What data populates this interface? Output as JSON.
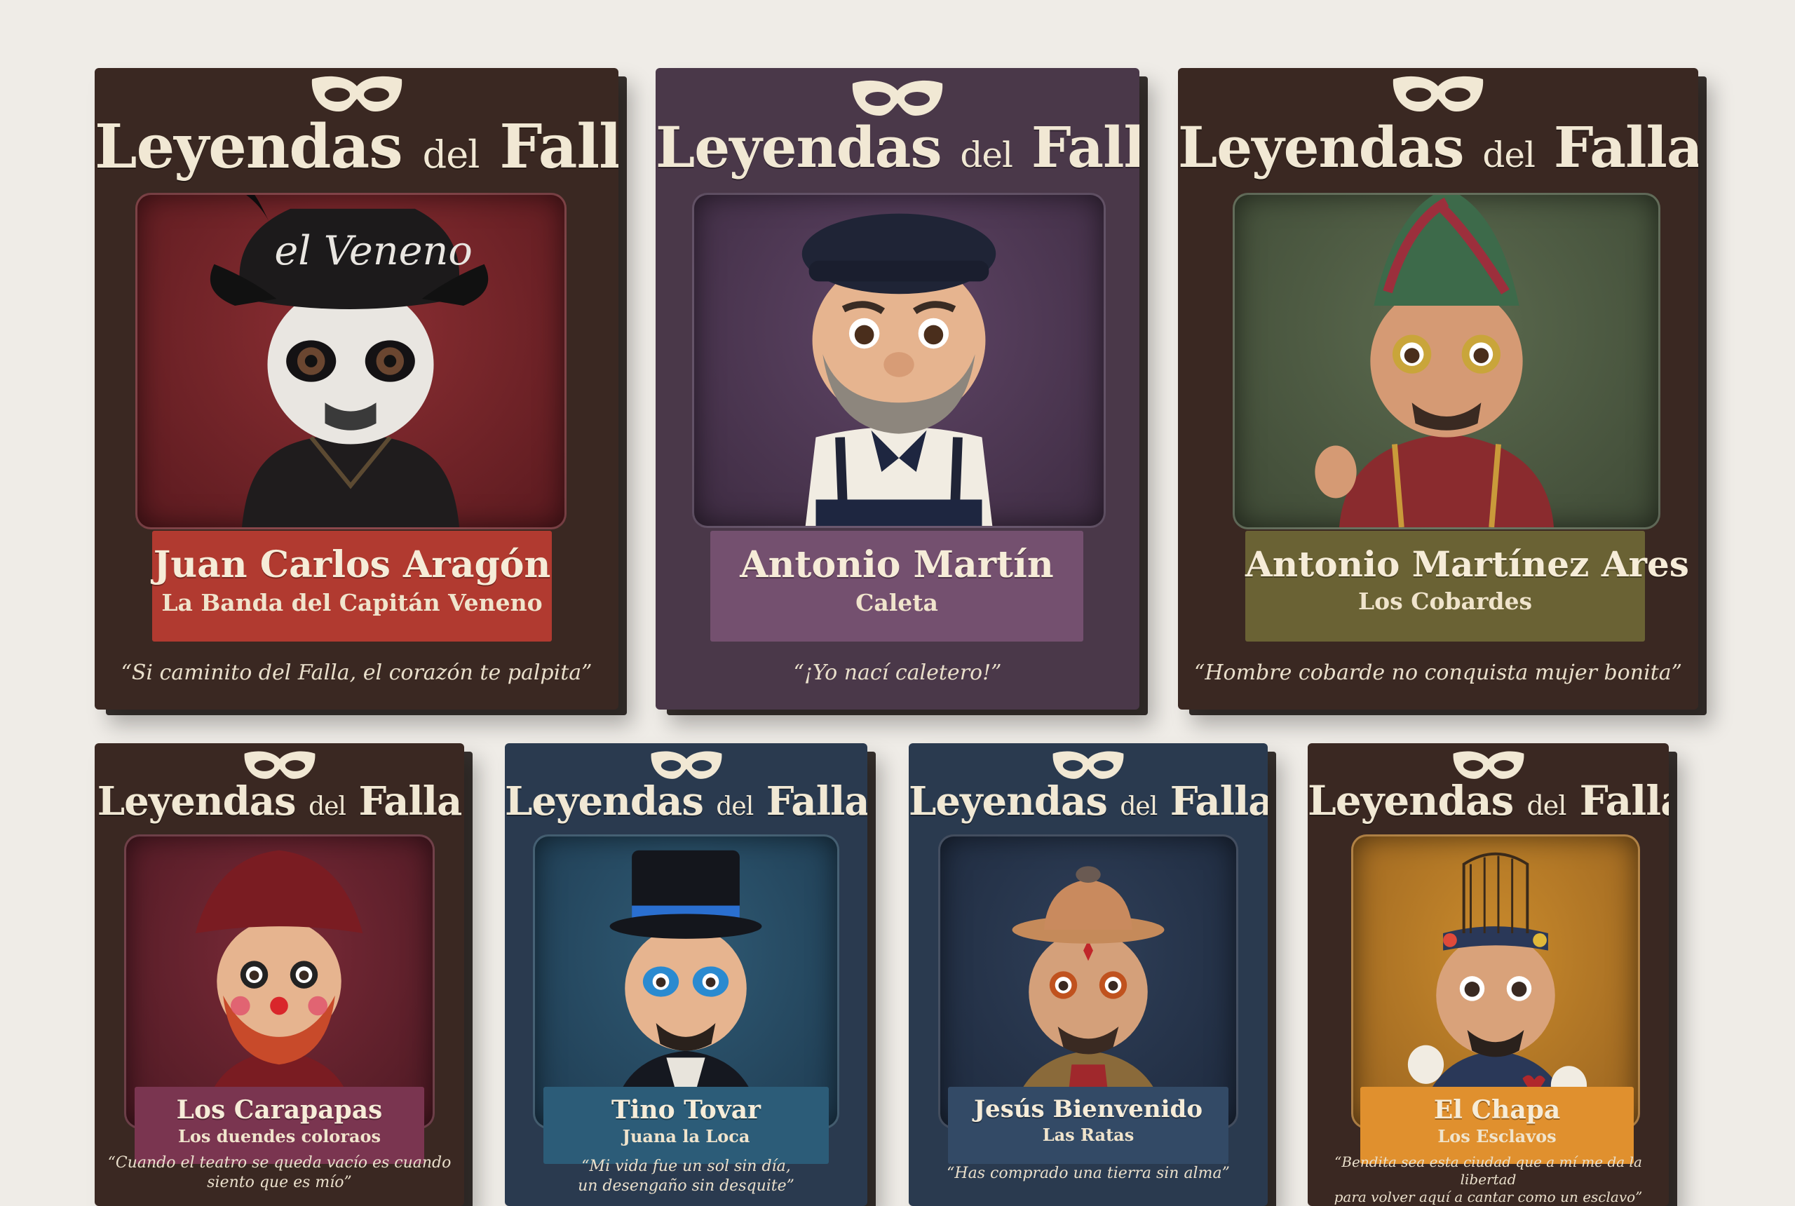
{
  "brand": {
    "title_main": "Leyendas",
    "title_small": "del",
    "title_end": "Falla",
    "icon": "carnival-mask-icon"
  },
  "colors": {
    "background": "#efece7",
    "card_brown": "#3b2a24",
    "card_purple": "#4a3849",
    "card_navy": "#2a3a4f",
    "text_cream": "#f1e8d4"
  },
  "cards": [
    {
      "name": "Juan Carlos Aragón",
      "group": "La Banda del Capitán Veneno",
      "quote": "“Si caminito del Falla,  el corazón te palpita”",
      "hat_text": "el Veneno"
    },
    {
      "name": "Antonio Martín",
      "group": "Caleta",
      "quote": "“¡Yo nací caletero!”"
    },
    {
      "name": "Antonio Martínez Ares",
      "group": "Los Cobardes",
      "quote": "“Hombre cobarde no conquista mujer bonita”"
    },
    {
      "name": "Los  Carapapas",
      "group": "Los duendes coloraos",
      "quote_line1": "“Cuando el teatro se queda vacío es cuando",
      "quote_line2": "siento que es mío”"
    },
    {
      "name": "Tino Tovar",
      "group": "Juana la Loca",
      "quote_line1": "“Mi vida fue un sol sin día,",
      "quote_line2": "un desengaño sin desquite”"
    },
    {
      "name": "Jesús Bienvenido",
      "group": "Las Ratas",
      "quote": "“Has comprado una tierra sin alma”"
    },
    {
      "name": "El Chapa",
      "group": "Los Esclavos",
      "quote_line1": "“Bendita sea esta ciudad que a mí me da la libertad",
      "quote_line2": "para volver aquí a cantar como un esclavo”"
    }
  ]
}
